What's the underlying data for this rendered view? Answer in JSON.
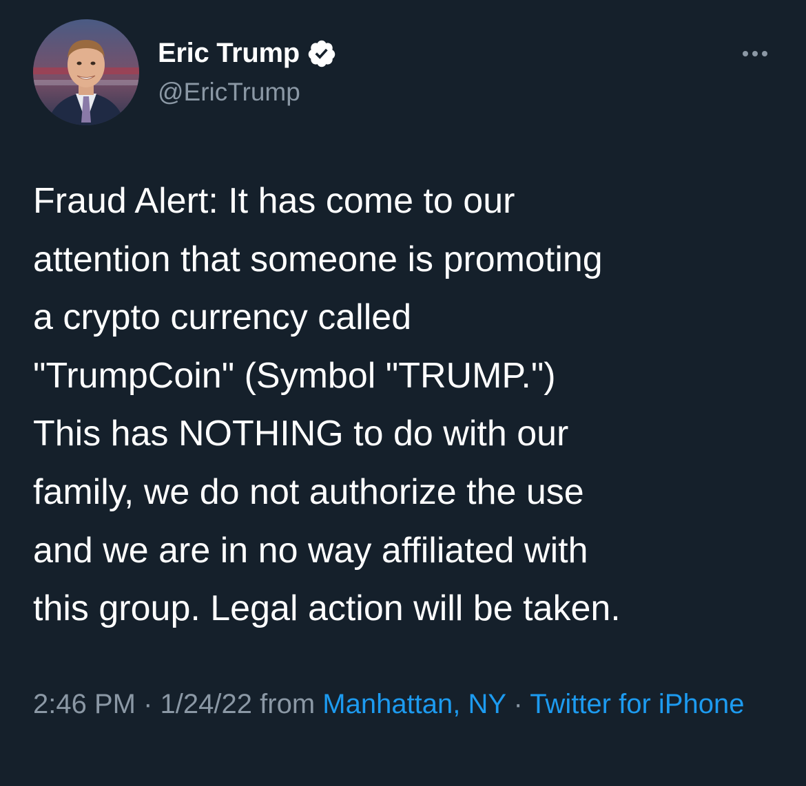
{
  "author": {
    "display_name": "Eric Trump",
    "handle": "@EricTrump",
    "verified": true
  },
  "more_icon": "ellipsis-icon",
  "tweet": {
    "text": "Fraud Alert: It has come to our\nattention that someone is promoting\na crypto currency called\n\"TrumpCoin\" (Symbol  \"TRUMP.\")\nThis has NOTHING to do with our\nfamily, we do not authorize the use\nand we are in no way affiliated with\nthis group. Legal action will be taken."
  },
  "meta": {
    "time": "2:46 PM",
    "separator": "·",
    "date": "1/24/22",
    "from_label": "from",
    "location": "Manhattan, NY",
    "source": "Twitter for iPhone"
  },
  "colors": {
    "background": "#15202b",
    "primary_text": "#ffffff",
    "secondary_text": "#8b98a5",
    "link": "#1d9bf0"
  }
}
